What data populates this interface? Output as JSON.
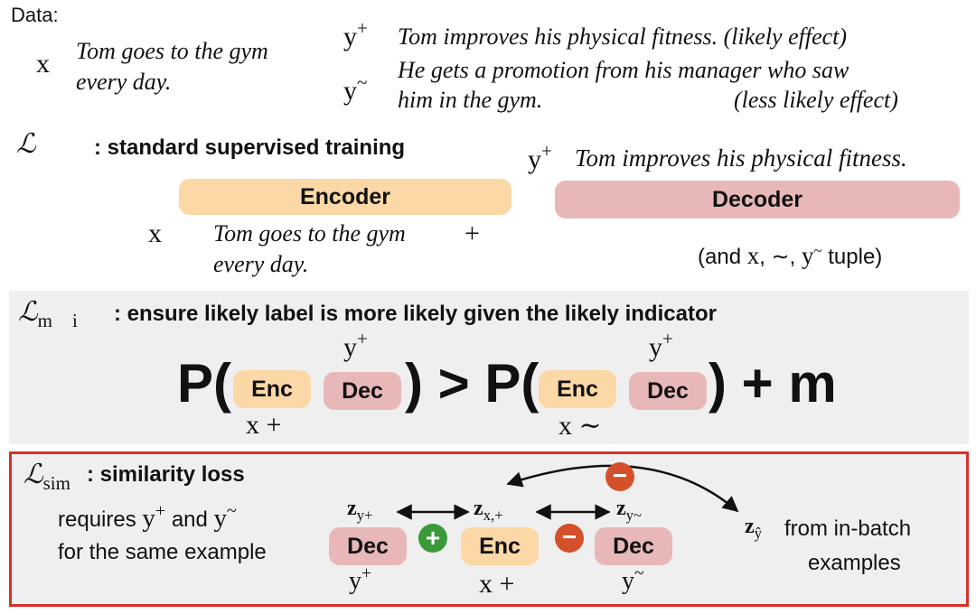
{
  "data_section": {
    "title": "Data:",
    "x_symbol": "x",
    "x_text_line1": "Tom goes to the gym",
    "x_text_line2": "every day.",
    "yplus_symbol": "y",
    "yplus_sup": "+",
    "yplus_text": "Tom improves his physical fitness. (likely effect)",
    "ytilde_symbol": "y",
    "ytilde_sup": "~",
    "ytilde_text_line1": "He gets a promotion from his manager who saw",
    "ytilde_text_line2": "him in the gym.",
    "ytilde_note": "(less likely effect)"
  },
  "standard_section": {
    "loss_symbol": "ℒ",
    "label": ": standard supervised training",
    "target_symbol": "y",
    "target_sup": "+",
    "target_text": "Tom improves his physical fitness.",
    "encoder_label": "Encoder",
    "decoder_label": "Decoder",
    "x_symbol": "x",
    "input_text_line1": "Tom goes to the gym",
    "input_text_line2": "every day.",
    "indicator": "+",
    "tuple_note_prefix": "(and ",
    "tuple_note_x": "x",
    "tuple_note_mid": ", ∼, ",
    "tuple_note_y": "y",
    "tuple_note_y_sup": "~",
    "tuple_note_suffix": " tuple)"
  },
  "margin_section": {
    "loss_symbol": "ℒ",
    "loss_sub": "m",
    "loss_sub2": "i",
    "label": ": ensure likely label is more likely given the likely indicator",
    "p_open_1": "P(",
    "enc_1": "Enc",
    "dec_1": "Dec",
    "y_1": "y",
    "y_1_sup": "+",
    "x_1": "x +",
    "close_gt": ") > P(",
    "enc_2": "Enc",
    "dec_2": "Dec",
    "y_2": "y",
    "y_2_sup": "+",
    "x_2": "x ∼",
    "close_plus_m": ") + m"
  },
  "sim_section": {
    "loss_symbol": "ℒ",
    "loss_sub": "sim",
    "label": ": similarity loss",
    "req_line1_a": "requires ",
    "req_y1": "y",
    "req_y1_sup": "+",
    "req_line1_b": " and ",
    "req_y2": "y",
    "req_y2_sup": "~",
    "req_line2": "for the same example",
    "z_yplus": "z",
    "z_yplus_sub": "y+",
    "z_xplus": "z",
    "z_xplus_sub": "x,+",
    "z_ytilde": "z",
    "z_ytilde_sub": "y~",
    "z_yhat": "z",
    "z_yhat_sub": "ŷ",
    "dec_left": "Dec",
    "enc_mid": "Enc",
    "dec_right": "Dec",
    "under_left": "y",
    "under_left_sup": "+",
    "under_mid": "x +",
    "under_right": "y",
    "under_right_sup": "~",
    "plus_sign": "+",
    "minus_sign": "−",
    "minus_sign_top": "−",
    "from_line1": "from in-batch",
    "from_line2": "examples"
  },
  "colors": {
    "encoder": "#fbd8a6",
    "decoder": "#e8b8b8",
    "panel": "#efefef",
    "border_red": "#d8302a",
    "plus_green": "#3a9a3a",
    "minus_red": "#d4502a"
  }
}
